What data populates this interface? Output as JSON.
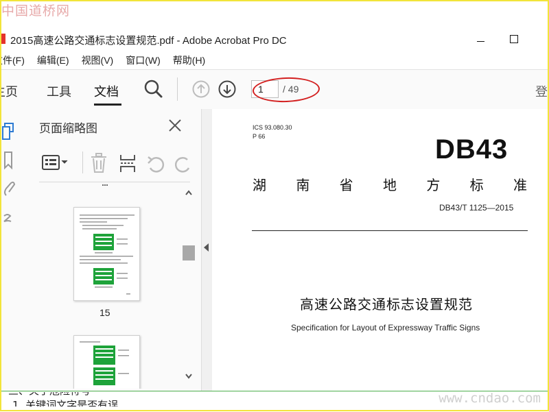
{
  "watermark": {
    "top": "中国道桥网",
    "bottom": "www.cndao.com"
  },
  "window": {
    "title": "2015高速公路交通标志设置规范.pdf - Adobe Acrobat Pro DC"
  },
  "menu": [
    "文件(F)",
    "编辑(E)",
    "视图(V)",
    "窗口(W)",
    "帮助(H)"
  ],
  "toolbar": {
    "tabs": [
      "主页",
      "工具",
      "文档"
    ],
    "active_tab": "文档",
    "page_current": "1",
    "page_total": "/ 49",
    "login": "登"
  },
  "panel": {
    "title": "页面缩略图",
    "thumb_label": "15",
    "colors": {
      "sign_green": "#1ea33a",
      "highlight": "#d31f1f"
    }
  },
  "document": {
    "ics": "ICS 93.080.30",
    "p": "P 66",
    "db": "DB43",
    "standard_chars": [
      "湖",
      "南",
      "省",
      "地",
      "方",
      "标",
      "准"
    ],
    "code": "DB43/T 1125—2015",
    "title_cn": "高速公路交通标志设置规范",
    "title_en": "Specification for Layout of Expressway Traffic Signs"
  },
  "article": {
    "line1": "三、关于危险符号",
    "line2": "1. 关键词文字是否有误"
  }
}
